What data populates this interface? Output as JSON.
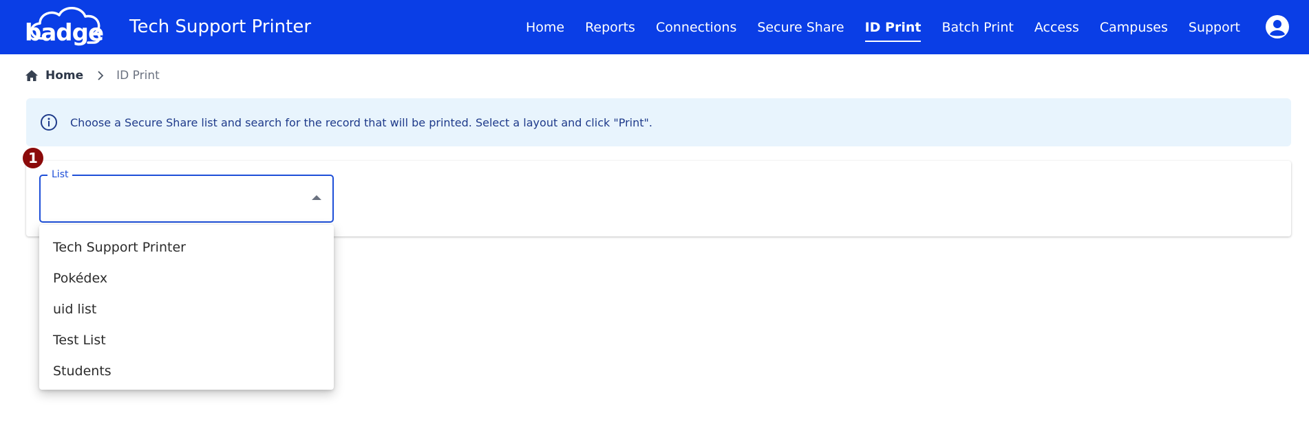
{
  "header": {
    "logo_text": "badge",
    "app_title": "Tech Support Printer",
    "nav": [
      {
        "label": "Home"
      },
      {
        "label": "Reports"
      },
      {
        "label": "Connections"
      },
      {
        "label": "Secure Share"
      },
      {
        "label": "ID Print",
        "active": true
      },
      {
        "label": "Batch Print"
      },
      {
        "label": "Access"
      },
      {
        "label": "Campuses"
      },
      {
        "label": "Support"
      }
    ],
    "account_icon": "account-circle-icon"
  },
  "breadcrumb": {
    "home": "Home",
    "current": "ID Print"
  },
  "info": {
    "text": "Choose a Secure Share list and search for the record that will be printed. Select a layout and click \"Print\"."
  },
  "step": {
    "number": "1"
  },
  "list_select": {
    "label": "List",
    "value": "",
    "options": [
      "Tech Support Printer",
      "Pokédex",
      "uid list",
      "Test List",
      "Students"
    ]
  },
  "colors": {
    "header_bg": "#0a3ee6",
    "info_bg": "#e8f4fd",
    "info_text": "#1e3a8a",
    "accent": "#1d4ed8",
    "badge": "#8b0a0a"
  }
}
